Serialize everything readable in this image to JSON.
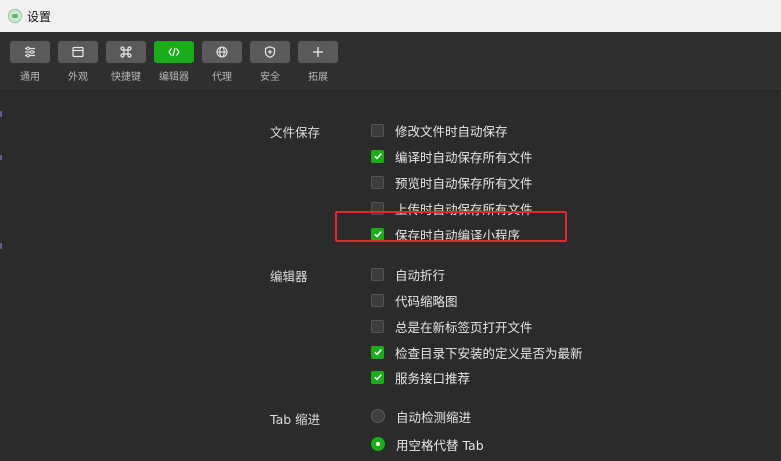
{
  "window": {
    "title": "设置"
  },
  "toolbar": {
    "items": [
      {
        "label": "通用",
        "icon": "sliders-icon",
        "active": false
      },
      {
        "label": "外观",
        "icon": "window-icon",
        "active": false
      },
      {
        "label": "快捷键",
        "icon": "command-icon",
        "active": false
      },
      {
        "label": "编辑器",
        "icon": "code-icon",
        "active": true
      },
      {
        "label": "代理",
        "icon": "globe-icon",
        "active": false
      },
      {
        "label": "安全",
        "icon": "shield-icon",
        "active": false
      },
      {
        "label": "拓展",
        "icon": "plus-icon",
        "active": false
      }
    ]
  },
  "sections": {
    "file_save": {
      "title": "文件保存",
      "options": [
        {
          "label": "修改文件时自动保存",
          "checked": false
        },
        {
          "label": "编译时自动保存所有文件",
          "checked": true
        },
        {
          "label": "预览时自动保存所有文件",
          "checked": false
        },
        {
          "label": "上传时自动保存所有文件",
          "checked": false
        },
        {
          "label": "保存时自动编译小程序",
          "checked": true
        }
      ]
    },
    "editor": {
      "title": "编辑器",
      "options": [
        {
          "label": "自动折行",
          "checked": false
        },
        {
          "label": "代码缩略图",
          "checked": false
        },
        {
          "label": "总是在新标签页打开文件",
          "checked": false
        },
        {
          "label": "检查目录下安装的定义是否为最新",
          "checked": true
        },
        {
          "label": "服务接口推荐",
          "checked": true
        }
      ]
    },
    "tab_indent": {
      "title": "Tab 缩进",
      "options": [
        {
          "label": "自动检测缩进",
          "selected": false
        },
        {
          "label": "用空格代替 Tab",
          "selected": true
        }
      ]
    }
  },
  "colors": {
    "accent": "#1aad19",
    "highlight": "#e0282e",
    "background": "#2b2b2b"
  }
}
